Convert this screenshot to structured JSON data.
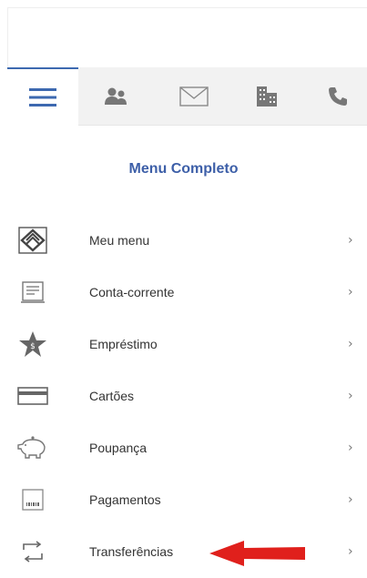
{
  "tabs": [
    {
      "icon": "hamburger-menu-icon",
      "active": true
    },
    {
      "icon": "users-icon",
      "active": false
    },
    {
      "icon": "envelope-icon",
      "active": false
    },
    {
      "icon": "building-icon",
      "active": false
    },
    {
      "icon": "phone-icon",
      "active": false
    }
  ],
  "menu": {
    "title": "Menu Completo",
    "chevron": "›",
    "items": [
      {
        "label": "Meu menu",
        "icon": "bank-logo-icon"
      },
      {
        "label": "Conta-corrente",
        "icon": "statement-icon"
      },
      {
        "label": "Empréstimo",
        "icon": "star-coin-icon"
      },
      {
        "label": "Cartões",
        "icon": "credit-card-icon"
      },
      {
        "label": "Poupança",
        "icon": "piggy-bank-icon"
      },
      {
        "label": "Pagamentos",
        "icon": "barcode-icon"
      },
      {
        "label": "Transferências",
        "icon": "transfer-arrows-icon"
      }
    ]
  },
  "colors": {
    "accent": "#3d69b0",
    "title": "#3d5fa8",
    "icon_gray": "#777777",
    "annotation_arrow": "#e0201c"
  }
}
